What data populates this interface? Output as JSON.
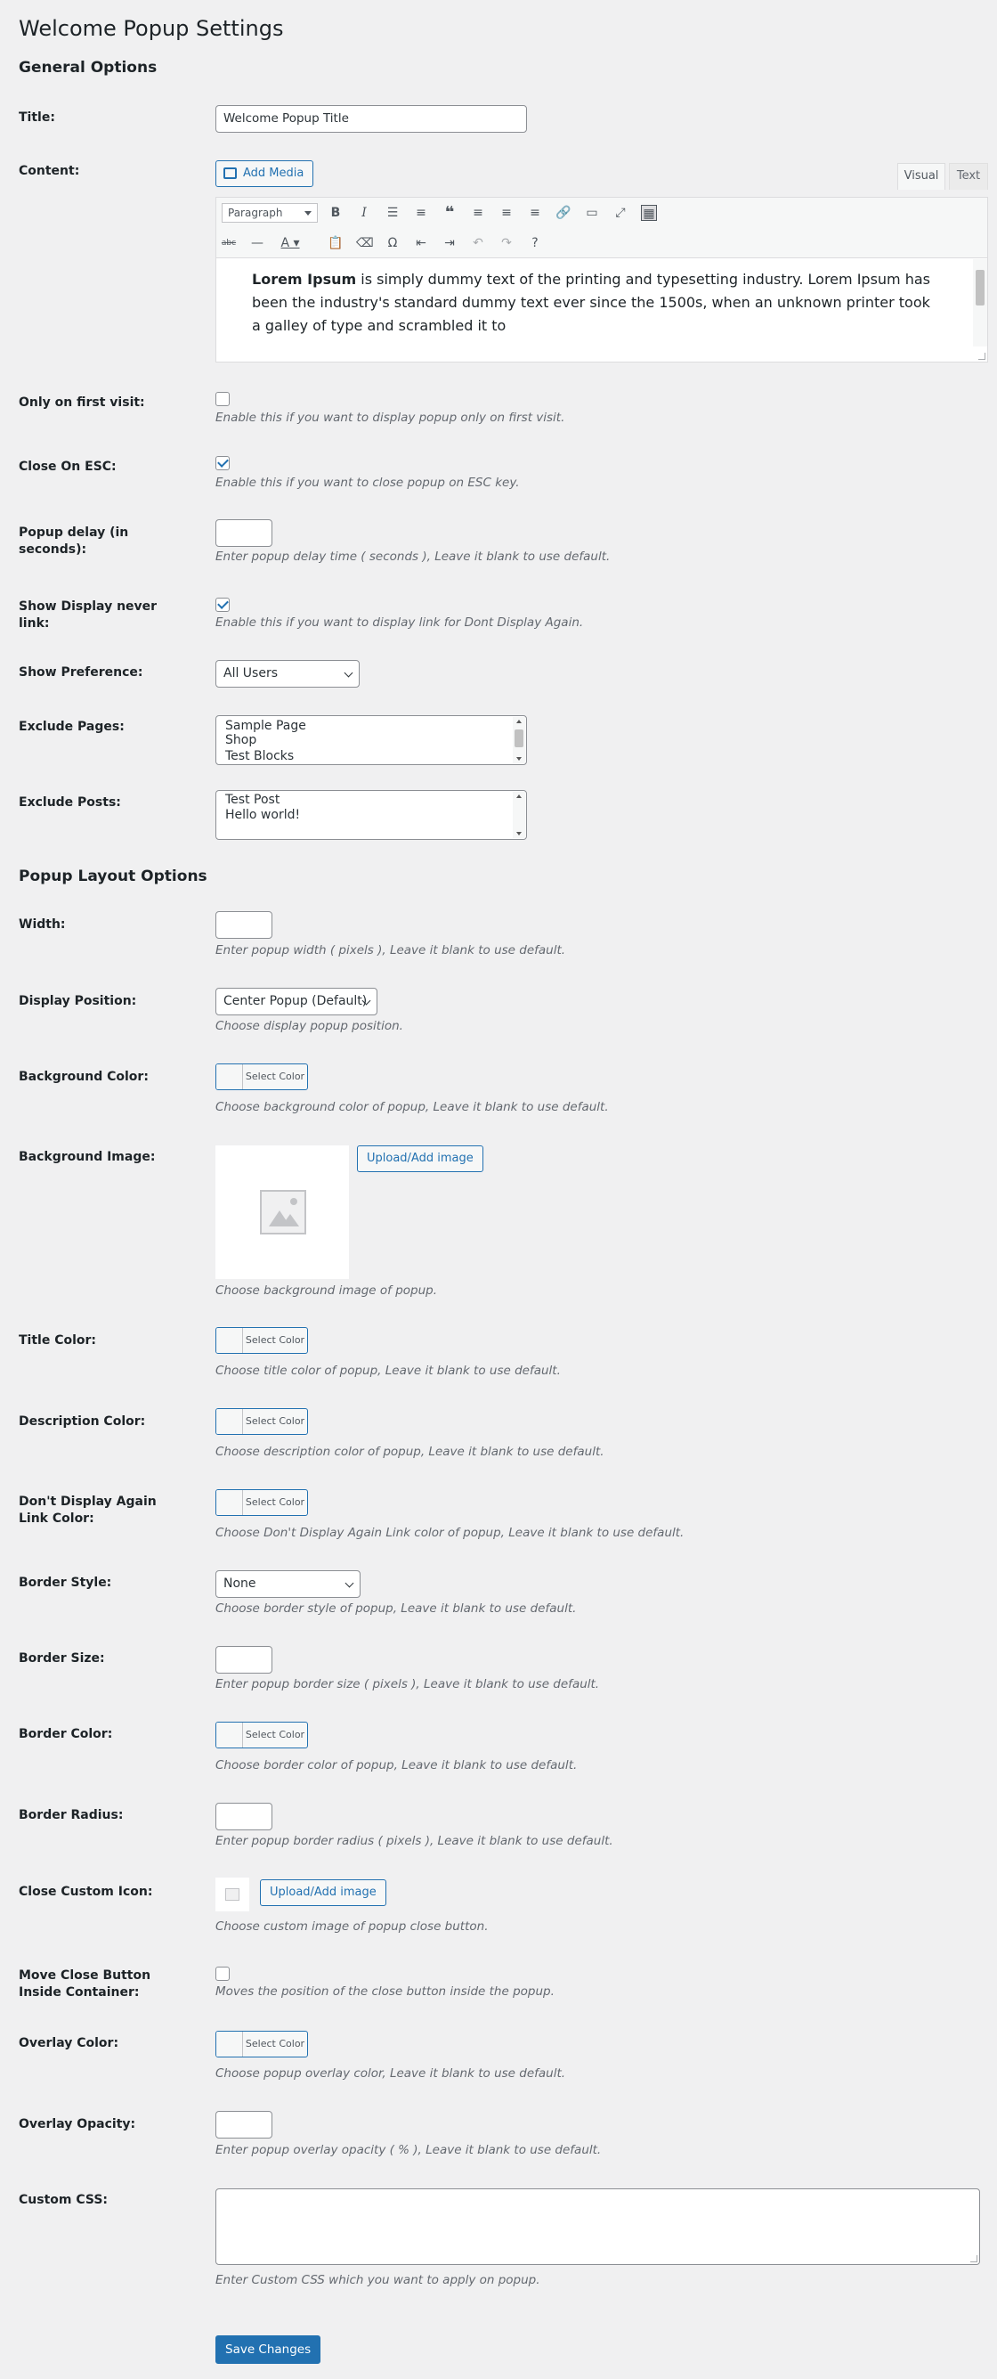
{
  "page": {
    "title": "Welcome Popup Settings"
  },
  "sections": {
    "general": "General Options",
    "layout": "Popup Layout Options"
  },
  "fields": {
    "title": {
      "label": "Title:",
      "value": "Welcome Popup Title"
    },
    "content": {
      "label": "Content:"
    },
    "first_visit": {
      "label": "Only on first visit:",
      "checked": false,
      "desc": "Enable this if you want to display popup only on first visit."
    },
    "close_esc": {
      "label": "Close On ESC:",
      "checked": true,
      "desc": "Enable this if you want to close popup on ESC key."
    },
    "delay": {
      "label": "Popup delay (in seconds):",
      "value": "",
      "desc": "Enter popup delay time ( seconds ), Leave it blank to use default."
    },
    "never_link": {
      "label": "Show Display never link:",
      "checked": true,
      "desc": "Enable this if you want to display link for Dont Display Again."
    },
    "preference": {
      "label": "Show Preference:",
      "value": "All Users"
    },
    "exclude_pages": {
      "label": "Exclude Pages:",
      "options": [
        "Sample Page",
        "Shop",
        "Test Blocks"
      ]
    },
    "exclude_posts": {
      "label": "Exclude Posts:",
      "options": [
        "Test Post",
        "Hello world!"
      ]
    },
    "width": {
      "label": "Width:",
      "value": "",
      "desc": "Enter popup width ( pixels ), Leave it blank to use default."
    },
    "position": {
      "label": "Display Position:",
      "value": "Center Popup (Default)",
      "desc": "Choose display popup position."
    },
    "bg_color": {
      "label": "Background Color:",
      "button": "Select Color",
      "desc": "Choose background color of popup, Leave it blank to use default."
    },
    "bg_image": {
      "label": "Background Image:",
      "button": "Upload/Add image",
      "desc": "Choose background image of popup."
    },
    "title_color": {
      "label": "Title Color:",
      "button": "Select Color",
      "desc": "Choose title color of popup, Leave it blank to use default."
    },
    "desc_color": {
      "label": "Description Color:",
      "button": "Select Color",
      "desc": "Choose description color of popup, Leave it blank to use default."
    },
    "link_color": {
      "label": "Don't Display Again Link Color:",
      "button": "Select Color",
      "desc": "Choose Don't Display Again Link color of popup, Leave it blank to use default."
    },
    "border_style": {
      "label": "Border Style:",
      "value": "None",
      "desc": "Choose border style of popup, Leave it blank to use default."
    },
    "border_size": {
      "label": "Border Size:",
      "value": "",
      "desc": "Enter popup border size ( pixels ), Leave it blank to use default."
    },
    "border_color": {
      "label": "Border Color:",
      "button": "Select Color",
      "desc": "Choose border color of popup, Leave it blank to use default."
    },
    "border_radius": {
      "label": "Border Radius:",
      "value": "",
      "desc": "Enter popup border radius ( pixels ), Leave it blank to use default."
    },
    "close_icon": {
      "label": "Close Custom Icon:",
      "button": "Upload/Add image",
      "desc": "Choose custom image of popup close button."
    },
    "close_inside": {
      "label": "Move Close Button Inside Container:",
      "checked": false,
      "desc": "Moves the position of the close button inside the popup."
    },
    "overlay_color": {
      "label": "Overlay Color:",
      "button": "Select Color",
      "desc": "Choose popup overlay color, Leave it blank to use default."
    },
    "overlay_opacity": {
      "label": "Overlay Opacity:",
      "value": "",
      "desc": "Enter popup overlay opacity ( % ), Leave it blank to use default."
    },
    "custom_css": {
      "label": "Custom CSS:",
      "value": "",
      "desc": "Enter Custom CSS which you want to apply on popup."
    }
  },
  "editor": {
    "add_media": "Add Media",
    "tab_visual": "Visual",
    "tab_text": "Text",
    "format": "Paragraph",
    "content_bold": "Lorem Ipsum",
    "content_rest": " is simply dummy text of the printing and typesetting industry. Lorem Ipsum has been the industry's standard dummy text ever since the 1500s, when an unknown printer took a galley of type and scrambled it to"
  },
  "submit": {
    "label": "Save Changes"
  },
  "colors": {
    "accent": "#2271b1",
    "background": "#f0f0f1",
    "text": "#1d2327",
    "muted": "#646970"
  }
}
